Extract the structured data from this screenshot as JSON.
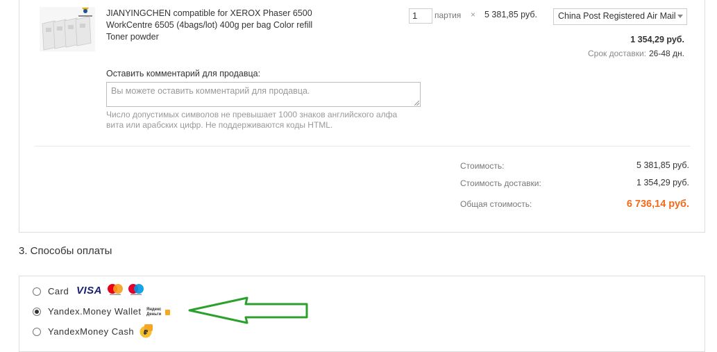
{
  "product": {
    "title": "JIANYINGCHEN compatible for XEROX Phaser 6500 WorkCentre 6505 (4bags/lot) 400g per bag Color refill Toner powder",
    "quantity": "1",
    "unit": "партия",
    "times": "×",
    "unit_price": "5 381,85 руб.",
    "shipping_method": "China Post Registered Air Mail",
    "shipping_cost": "1 354,29 руб.",
    "delivery_label": "Срок доставки:",
    "delivery_time": "26-48 дн."
  },
  "comment": {
    "label": "Оставить комментарий для продавца:",
    "placeholder": "Вы можете оставить комментарий для продавца.",
    "help": "Число допустимых символов не превышает 1000 знаков английского алфавита или арабских цифр. Не поддерживаются коды HTML."
  },
  "summary": {
    "cost_label": "Стоимость:",
    "cost_value": "5 381,85 руб.",
    "shipping_label": "Стоимость доставки:",
    "shipping_value": "1 354,29 руб.",
    "total_label": "Общая стоимость:",
    "total_value": "6 736,14 руб."
  },
  "payment": {
    "section_title": "3. Способы оплаты",
    "visa_text": "VISA",
    "yandex_logo_text": "Яндекс Деньги",
    "methods": [
      {
        "label": "Card",
        "selected": false
      },
      {
        "label": "Yandex.Money Wallet",
        "selected": true
      },
      {
        "label": "YandexMoney Cash",
        "selected": false
      }
    ]
  },
  "colors": {
    "total": "#f26a1b",
    "annotation_arrow": "#2ca02c",
    "yandex_orange": "#f5a623"
  }
}
